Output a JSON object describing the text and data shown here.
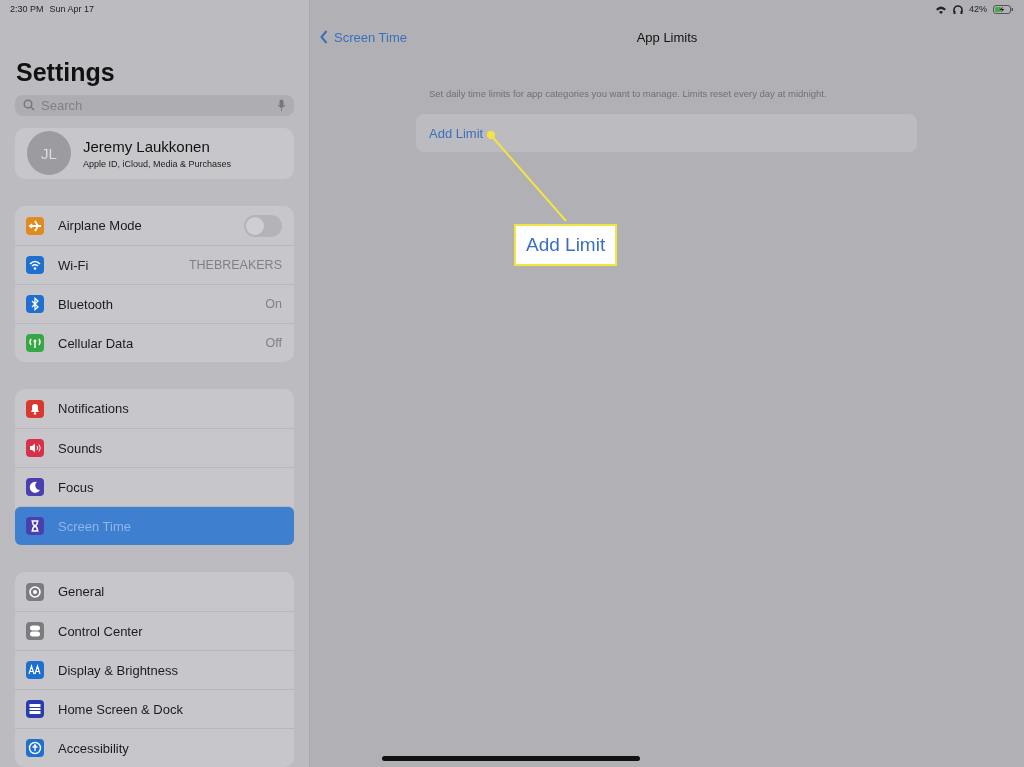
{
  "status_bar": {
    "time": "2:30 PM",
    "date": "Sun Apr 17",
    "battery": "42%",
    "charging": true
  },
  "sidebar": {
    "title": "Settings",
    "search": {
      "placeholder": "Search"
    },
    "profile": {
      "initials": "JL",
      "name": "Jeremy Laukkonen",
      "subtitle": "Apple ID, iCloud, Media & Purchases"
    },
    "groups": [
      {
        "items": [
          {
            "label": "Airplane Mode",
            "kind": "toggle",
            "on": false,
            "selected": false,
            "color": "#e08a20"
          },
          {
            "label": "Wi-Fi",
            "kind": "value",
            "value": "THEBREAKERS",
            "selected": false,
            "color": "#1f6fd0"
          },
          {
            "label": "Bluetooth",
            "kind": "value",
            "value": "On",
            "selected": false,
            "color": "#1f6fd0"
          },
          {
            "label": "Cellular Data",
            "kind": "value",
            "value": "Off",
            "selected": false,
            "color": "#35a845"
          }
        ]
      },
      {
        "items": [
          {
            "label": "Notifications",
            "kind": "link",
            "selected": false,
            "color": "#d8392d"
          },
          {
            "label": "Sounds",
            "kind": "link",
            "selected": false,
            "color": "#d8304a"
          },
          {
            "label": "Focus",
            "kind": "link",
            "selected": false,
            "color": "#4b3fb0"
          },
          {
            "label": "Screen Time",
            "kind": "link",
            "selected": true,
            "color": "#4b3fb0"
          }
        ]
      },
      {
        "items": [
          {
            "label": "General",
            "kind": "link",
            "selected": false,
            "color": "#7c7c80"
          },
          {
            "label": "Control Center",
            "kind": "link",
            "selected": false,
            "color": "#7c7c80"
          },
          {
            "label": "Display & Brightness",
            "kind": "link",
            "selected": false,
            "color": "#1f6fd0"
          },
          {
            "label": "Home Screen & Dock",
            "kind": "link",
            "selected": false,
            "color": "#2a3bb0"
          },
          {
            "label": "Accessibility",
            "kind": "link",
            "selected": false,
            "color": "#1f6fd0"
          }
        ]
      }
    ]
  },
  "detail": {
    "back": "Screen Time",
    "title": "App Limits",
    "description": "Set daily time limits for app categories you want to manage. Limits reset every day at midnight.",
    "add_limit": "Add Limit",
    "callout": {
      "label": "Add Limit"
    }
  }
}
